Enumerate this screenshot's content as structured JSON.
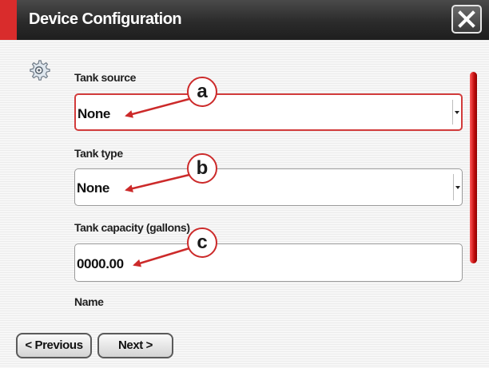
{
  "window": {
    "title": "Device Configuration",
    "accent_color": "#d92c2c",
    "close_icon": "close-icon"
  },
  "settings_icon": "gear-icon",
  "fields": [
    {
      "label": "Tank source",
      "value": "None",
      "type": "dropdown",
      "active": true
    },
    {
      "label": "Tank type",
      "value": "None",
      "type": "dropdown",
      "active": false
    },
    {
      "label": "Tank capacity (gallons)",
      "value": "0000.00",
      "type": "text",
      "active": false
    },
    {
      "label": "Name"
    }
  ],
  "callouts": [
    "a",
    "b",
    "c"
  ],
  "nav": {
    "previous_label": "< Previous",
    "next_label": "Next >"
  },
  "colors": {
    "callout_border": "#cc2a2a",
    "scrollbar": "#c20e0e"
  }
}
